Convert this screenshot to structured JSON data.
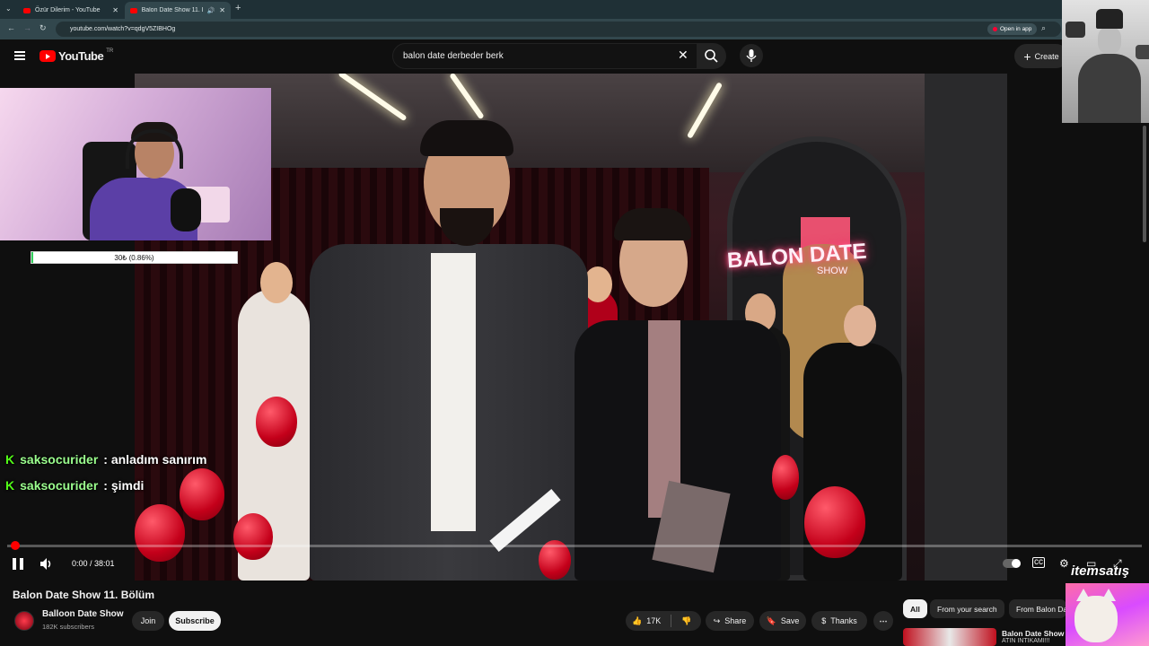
{
  "browser": {
    "tabs": [
      {
        "title": "Özür Dilerim - YouTube",
        "active": false
      },
      {
        "title": "Balon Date Show 11. Bölüm",
        "active": true
      }
    ],
    "url": "youtube.com/watch?v=qdgV5ZIBHOg",
    "open_in_app": "Open in app"
  },
  "youtube": {
    "logo": "YouTube",
    "country_code": "TR",
    "search_query": "balon date derbeder berk",
    "create_label": "Create"
  },
  "stream_overlay": {
    "goal_text": "30₺ (0.86%)",
    "goal_progress": 0.0086,
    "chat": [
      {
        "badge": "K",
        "user": "saksocurider",
        "message": ": anladım sanırım"
      },
      {
        "badge": "K",
        "user": "saksocurider",
        "message": ": şimdi"
      }
    ],
    "watermark": "itemsatış"
  },
  "video_scene": {
    "neon_sign": "BALON DATE",
    "neon_sub": "SHOW"
  },
  "player": {
    "time": "0:00 / 38:01",
    "progress": 0.0
  },
  "video_info": {
    "title": "Balon Date Show 11. Bölüm",
    "channel": "Balloon Date Show",
    "subscribers": "182K subscribers",
    "join": "Join",
    "subscribe": "Subscribe",
    "likes": "17K",
    "share": "Share",
    "save": "Save",
    "thanks": "Thanks"
  },
  "sidebar": {
    "chips": [
      "All",
      "From your search",
      "From Balon Da"
    ],
    "recommendation": {
      "title": "Balon Date Show 1",
      "subtitle": "ATIN İNTİKAMI!!!"
    }
  },
  "colors": {
    "accent_red": "#ff0000",
    "kick_green": "#53fc18",
    "background": "#0f0f0f"
  }
}
